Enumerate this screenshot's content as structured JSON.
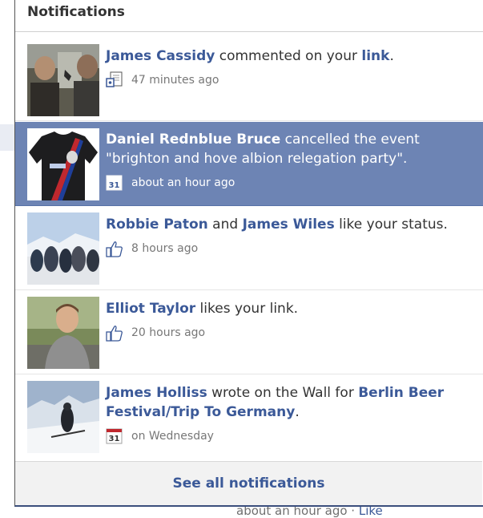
{
  "panel": {
    "title": "Notifications",
    "see_all": "See all notifications"
  },
  "background": {
    "time_text": "about an hour ago",
    "separator": " · ",
    "like_text": "Like"
  },
  "colors": {
    "accent": "#3b5998",
    "selected": "#6d84b4"
  },
  "notifications": [
    {
      "actor": "James Cassidy",
      "text1": " commented on your ",
      "target": "link",
      "text2": ".",
      "icon": "comment-icon",
      "time": "47 minutes ago",
      "selected": false
    },
    {
      "actor": "Daniel Rednblue Bruce",
      "text1": " cancelled the event \"brighton and hove albion relegation party\".",
      "icon": "calendar-icon",
      "time": "about an hour ago",
      "selected": true
    },
    {
      "actor": "Robbie Paton",
      "text1": " and ",
      "actor2": "James Wiles",
      "text2": " like your status.",
      "icon": "like-icon",
      "time": "8 hours ago",
      "selected": false
    },
    {
      "actor": "Elliot Taylor",
      "text1": " likes your link.",
      "icon": "like-icon",
      "time": "20 hours ago",
      "selected": false
    },
    {
      "actor": "James Holliss",
      "text1": " wrote on the Wall for ",
      "target": "Berlin Beer Festival/Trip To Germany",
      "text2": ".",
      "icon": "calendar-icon",
      "time": "on Wednesday",
      "selected": false
    }
  ]
}
